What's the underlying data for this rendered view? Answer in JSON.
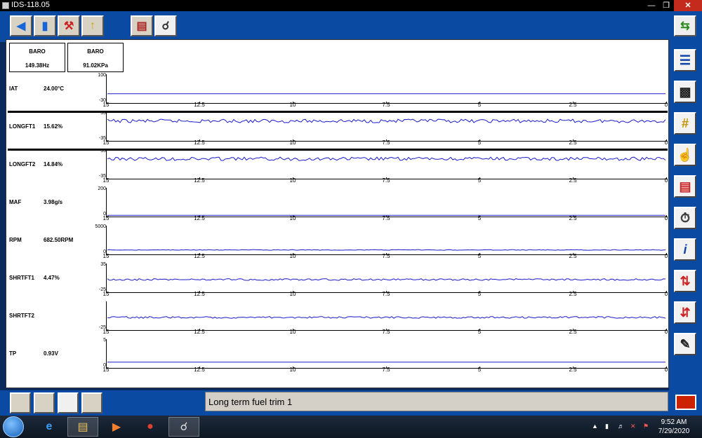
{
  "window": {
    "title": "IDS-118.05"
  },
  "status": {
    "text": "Long term fuel trim 1"
  },
  "clock": {
    "time": "9:52 AM",
    "date": "7/29/2020"
  },
  "baro": [
    {
      "name": "BARO",
      "value": "149.38Hz"
    },
    {
      "name": "BARO",
      "value": "91.02KPa"
    }
  ],
  "x_ticks": [
    "15",
    "12.5",
    "10",
    "7.5",
    "5",
    "2.5",
    "0"
  ],
  "panels": [
    {
      "name": "IAT",
      "value": "24.00°C",
      "ymax": "100",
      "ymin": "-30",
      "level": 0.32,
      "noise": 0
    },
    {
      "name": "LONGFT1",
      "value": "15.62%",
      "ymax": "35",
      "ymin": "-35",
      "level": 0.72,
      "noise": 0.06,
      "selected": true
    },
    {
      "name": "LONGFT2",
      "value": "14.84%",
      "ymax": "35",
      "ymin": "-35",
      "level": 0.72,
      "noise": 0.06,
      "selected": true
    },
    {
      "name": "MAF",
      "value": "3.98g/s",
      "ymax": "200",
      "ymin": "0",
      "level": 0.02,
      "noise": 0
    },
    {
      "name": "RPM",
      "value": "682.50RPM",
      "ymax": "5000",
      "ymin": "0",
      "level": 0.14,
      "noise": 0.01
    },
    {
      "name": "SHRTFT1",
      "value": "4.47%",
      "ymax": "35",
      "ymin": "-25",
      "level": 0.45,
      "noise": 0.03
    },
    {
      "name": "SHRTFT2",
      "value": "",
      "ymax": "",
      "ymin": "-25",
      "level": 0.45,
      "noise": 0.03
    },
    {
      "name": "TP",
      "value": "0.93V",
      "ymax": "5",
      "ymin": "0",
      "level": 0.19,
      "noise": 0
    }
  ],
  "colors": {
    "trace": "#1a1acc",
    "panel_bg": "#0b4aa3"
  }
}
